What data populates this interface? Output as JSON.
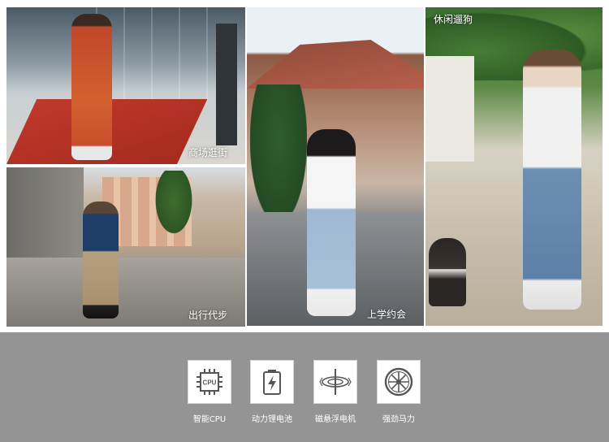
{
  "photos": {
    "mall": {
      "caption": "商场逛街"
    },
    "school": {
      "caption": "上学约会"
    },
    "park": {
      "caption": "休闲遛狗"
    },
    "street": {
      "caption": "出行代步"
    }
  },
  "features": [
    {
      "label": "智能CPU",
      "icon": "cpu-icon",
      "icon_text": "CPU"
    },
    {
      "label": "动力锂电池",
      "icon": "battery-icon"
    },
    {
      "label": "磁悬浮电机",
      "icon": "motor-icon"
    },
    {
      "label": "强劲马力",
      "icon": "wheel-icon"
    }
  ],
  "colors": {
    "feature_bar": "#949494",
    "icon_stroke": "#555555"
  }
}
